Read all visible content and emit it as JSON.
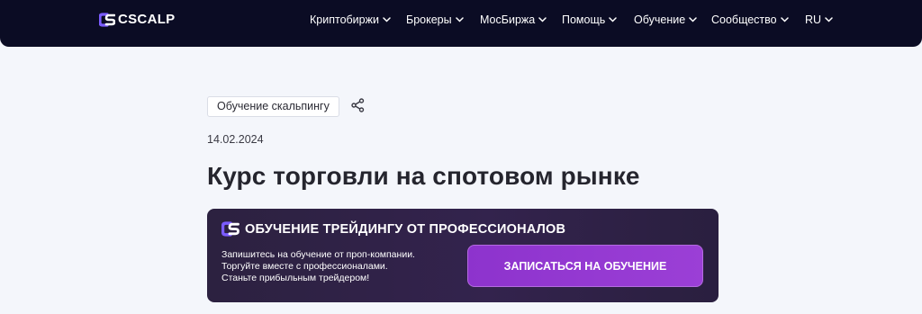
{
  "header": {
    "logo_text": "CSCALP",
    "nav": [
      {
        "label": "Криптобиржи"
      },
      {
        "label": "Брокеры"
      },
      {
        "label": "МосБиржа"
      },
      {
        "label": "Помощь"
      },
      {
        "label": "Обучение"
      },
      {
        "label": "Сообщество"
      }
    ],
    "lang": "RU"
  },
  "article": {
    "category": "Обучение скальпингу",
    "date": "14.02.2024",
    "title": "Курс торговли на спотовом рынке"
  },
  "promo": {
    "title": "ОБУЧЕНИЕ ТРЕЙДИНГУ ОТ ПРОФЕССИОНАЛОВ",
    "lines": [
      "Запишитесь на обучение от проп-компании.",
      "Торгуйте вместе с профессионалами.",
      "Станьте прибыльным трейдером!"
    ],
    "button_label": "ЗАПИСАТЬСЯ НА ОБУЧЕНИЕ"
  },
  "colors": {
    "topbar": "#0b0c24",
    "page_bg": "#f4f6fb",
    "promo_bg": "#2e2244",
    "accent": "#9b3fd6",
    "logo_accent": "#7b5cff"
  },
  "icons": {
    "logo": "cscalp-logo-icon",
    "chevron": "chevron-down-icon",
    "share": "share-icon"
  }
}
